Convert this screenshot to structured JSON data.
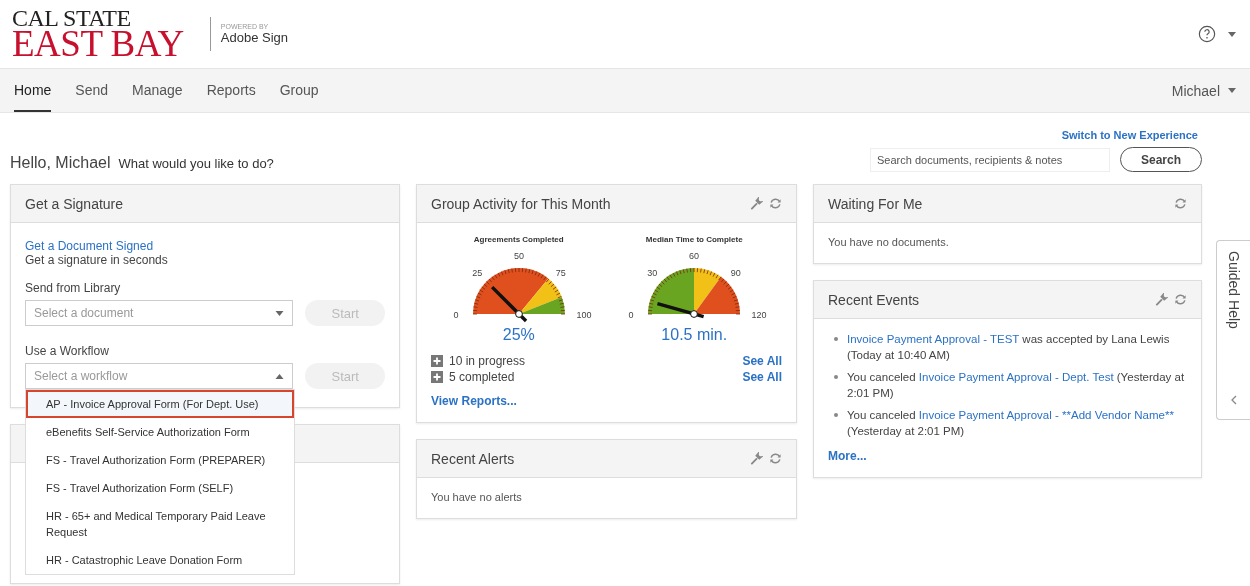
{
  "header": {
    "logo_top": "CAL STATE",
    "logo_bottom": "EAST BAY",
    "powered_by": "POWERED BY",
    "product": "Adobe Sign"
  },
  "nav": {
    "tabs": [
      {
        "label": "Home",
        "selected": true
      },
      {
        "label": "Send",
        "selected": false
      },
      {
        "label": "Manage",
        "selected": false
      },
      {
        "label": "Reports",
        "selected": false
      },
      {
        "label": "Group",
        "selected": false
      }
    ],
    "user": "Michael"
  },
  "greeting": {
    "hello": "Hello, Michael",
    "prompt": "What would you like to do?"
  },
  "switch_link": "Switch to New Experience",
  "search": {
    "placeholder": "Search documents, recipients & notes",
    "button": "Search"
  },
  "get_signature": {
    "title": "Get a Signature",
    "link": "Get a Document Signed",
    "subtitle": "Get a signature in seconds",
    "library": {
      "label": "Send from Library",
      "placeholder": "Select a document",
      "button": "Start"
    },
    "workflow": {
      "label": "Use a Workflow",
      "placeholder": "Select a workflow",
      "button": "Start",
      "expanded": true,
      "options": [
        {
          "label": "AP - Invoice Approval Form (For Dept. Use)",
          "selected": true
        },
        {
          "label": "eBenefits Self-Service Authorization Form",
          "selected": false
        },
        {
          "label": "FS - Travel Authorization Form (PREPARER)",
          "selected": false
        },
        {
          "label": "FS - Travel Authorization Form (SELF)",
          "selected": false
        },
        {
          "label": "HR - 65+ and Medical Temporary Paid Leave Request",
          "selected": false
        },
        {
          "label": "HR - Catastrophic Leave Donation Form",
          "selected": false
        }
      ]
    }
  },
  "group_activity": {
    "title": "Group Activity for This Month",
    "gauges": [
      {
        "title": "Agreements Completed",
        "ticks": [
          "0",
          "25",
          "50",
          "75",
          "100"
        ],
        "value": "25%",
        "bands": [
          {
            "color": "#e0501e"
          },
          {
            "color": "#f2c117"
          },
          {
            "color": "#6aa521"
          }
        ]
      },
      {
        "title": "Median Time to Complete",
        "ticks": [
          "0",
          "30",
          "60",
          "90",
          "120"
        ],
        "value": "10.5 min.",
        "bands": [
          {
            "color": "#6aa521"
          },
          {
            "color": "#f2c117"
          },
          {
            "color": "#e0501e"
          }
        ]
      }
    ],
    "stats": [
      {
        "text": "10 in progress",
        "link": "See All"
      },
      {
        "text": "5 completed",
        "link": "See All"
      }
    ],
    "footer_link": "View Reports..."
  },
  "recent_alerts": {
    "title": "Recent Alerts",
    "message": "You have no alerts"
  },
  "waiting": {
    "title": "Waiting For Me",
    "message": "You have no documents."
  },
  "recent_events": {
    "title": "Recent Events",
    "events": [
      [
        {
          "text": "Invoice Payment Approval - TEST",
          "link": true
        },
        {
          "text": " was accepted by Lana Lewis (Today at 10:40 AM)",
          "link": false
        }
      ],
      [
        {
          "text": "You canceled ",
          "link": false
        },
        {
          "text": "Invoice Payment Approval - Dept. Test",
          "link": true
        },
        {
          "text": " (Yesterday at 2:01 PM)",
          "link": false
        }
      ],
      [
        {
          "text": "You canceled ",
          "link": false
        },
        {
          "text": "Invoice Payment Approval - **Add Vendor Name**",
          "link": true
        },
        {
          "text": " (Yesterday at 2:01 PM)",
          "link": false
        }
      ]
    ],
    "more": "More..."
  },
  "guided_help": "Guided Help"
}
